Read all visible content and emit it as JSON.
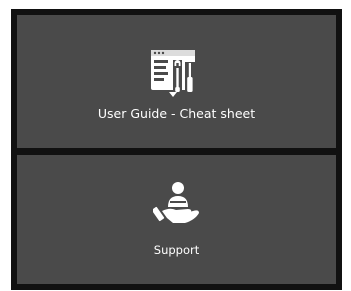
{
  "tiles": {
    "guide": {
      "label": "User Guide - Cheat sheet",
      "icon": "tools-document-icon"
    },
    "support": {
      "label": "Support",
      "icon": "hand-person-support-icon"
    }
  },
  "colors": {
    "frame": "#111111",
    "tile": "#4a4a4a",
    "text": "#ffffff"
  }
}
